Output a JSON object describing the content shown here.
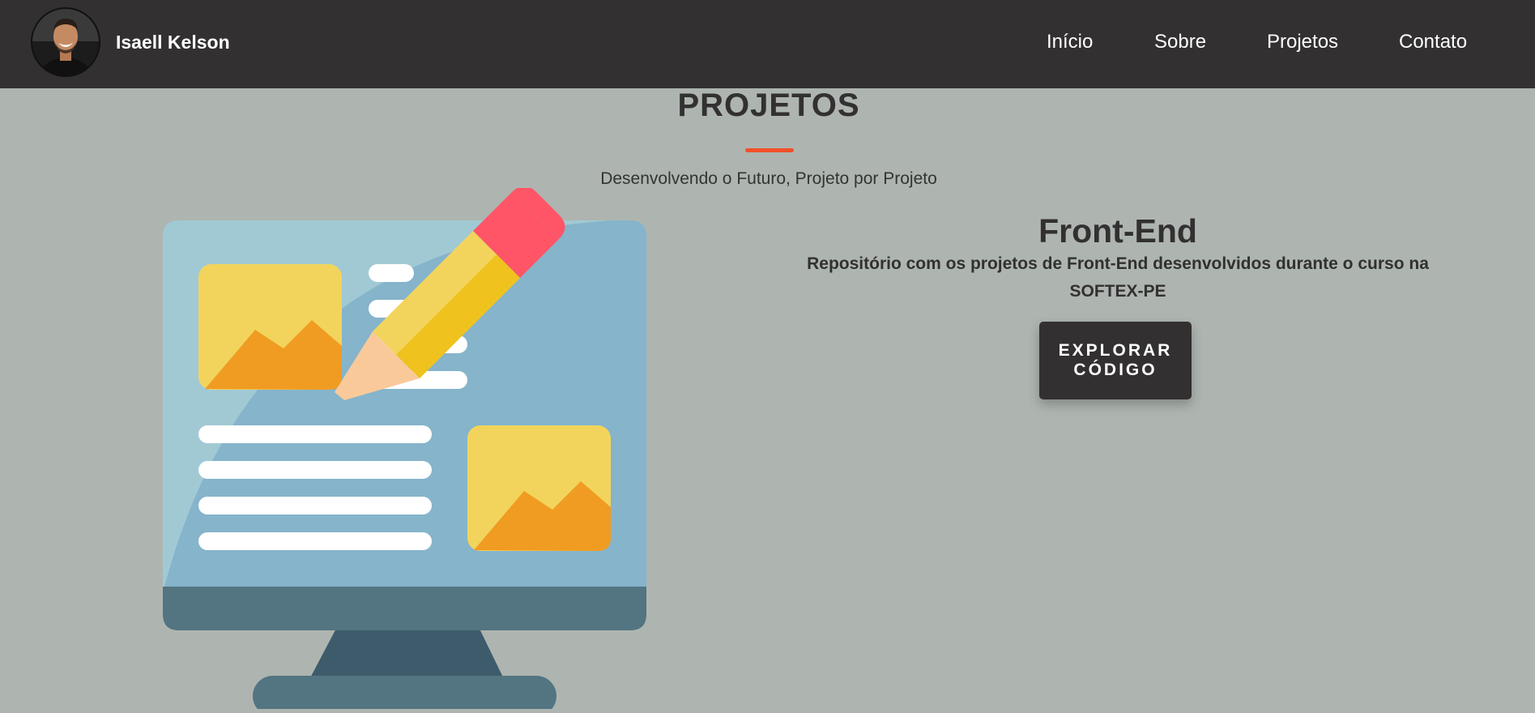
{
  "navbar": {
    "brand_name": "Isaell Kelson",
    "avatar_icon": "profile-photo",
    "links": [
      {
        "label": "Início"
      },
      {
        "label": "Sobre"
      },
      {
        "label": "Projetos"
      },
      {
        "label": "Contato"
      }
    ]
  },
  "section": {
    "title": "PROJETOS",
    "subtitle": "Desenvolvendo o Futuro, Projeto por Projeto",
    "accent_color": "#f2502a"
  },
  "project": {
    "illustration_icon": "monitor-with-pencil-illustration",
    "title": "Front-End",
    "description": "Repositório com os projetos de Front-End desenvolvidos durante o curso na SOFTEX-PE",
    "button_label": "EXPLORAR CÓDIGO"
  },
  "colors": {
    "navbar_background": "#323031",
    "page_background": "#aeb5b0",
    "button_background": "#323031",
    "text_dark": "#323031"
  }
}
